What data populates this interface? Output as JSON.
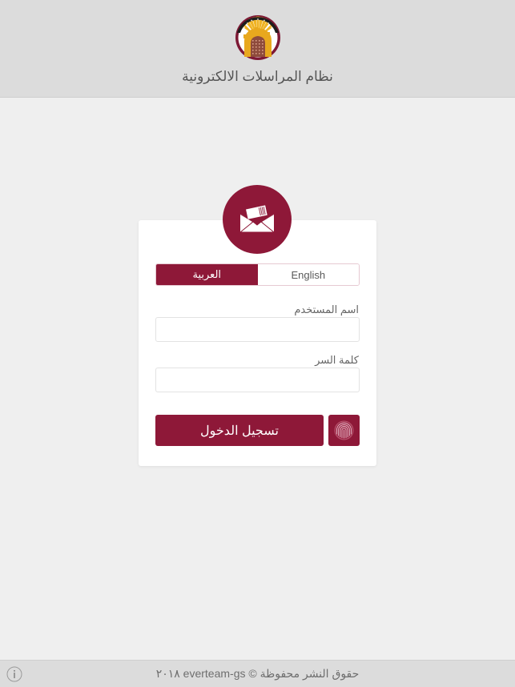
{
  "header": {
    "app_title": "نظام المراسلات الالكترونية",
    "logo_name": "ministry-gate-emblem"
  },
  "login_card": {
    "badge_icon": "envelope-icon",
    "language_toggle": {
      "english_label": "English",
      "arabic_label": "العربية",
      "active": "arabic"
    },
    "username": {
      "label": "اسم المستخدم",
      "value": "",
      "placeholder": ""
    },
    "password": {
      "label": "كلمة السر",
      "value": "",
      "placeholder": ""
    },
    "login_button_label": "تسجيل الدخول",
    "fingerprint_button_icon": "fingerprint-icon"
  },
  "footer": {
    "copyright": "حقوق النشر محفوظة © everteam-gs ٢٠١٨",
    "info_icon": "info-icon"
  },
  "colors": {
    "brand_maroon": "#8E1838",
    "header_bg": "#dcdcdc",
    "page_bg": "#efefef",
    "card_bg": "#ffffff",
    "logo_gold": "#F0B323"
  }
}
